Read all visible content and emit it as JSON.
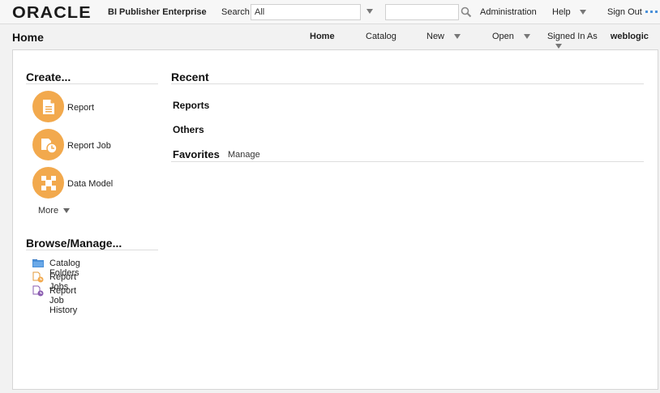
{
  "topbar": {
    "logo": "ORACLE",
    "product": "BI Publisher Enterprise",
    "search_label": "Search",
    "search_scope": "All",
    "search_value": "",
    "administration": "Administration",
    "help": "Help",
    "sign_out": "Sign Out"
  },
  "header": {
    "title": "Home",
    "nav": {
      "home": "Home",
      "catalog": "Catalog",
      "new": "New",
      "open": "Open",
      "signed_in_as": "Signed In As",
      "user": "weblogic"
    }
  },
  "create": {
    "title": "Create...",
    "items": [
      {
        "label": "Report",
        "icon": "report-icon"
      },
      {
        "label": "Report Job",
        "icon": "report-job-icon"
      },
      {
        "label": "Data Model",
        "icon": "data-model-icon"
      }
    ],
    "more": "More"
  },
  "browse": {
    "title": "Browse/Manage...",
    "items": [
      {
        "label": "Catalog Folders",
        "icon": "folder-icon"
      },
      {
        "label": "Report Jobs",
        "icon": "report-jobs-icon"
      },
      {
        "label": "Report Job History",
        "icon": "job-history-icon"
      }
    ]
  },
  "recent": {
    "title": "Recent",
    "reports": "Reports",
    "others": "Others"
  },
  "favorites": {
    "title": "Favorites",
    "manage": "Manage"
  },
  "colors": {
    "accent": "#f2a94d",
    "folder": "#4a90d9",
    "history": "#8a5bb0"
  }
}
